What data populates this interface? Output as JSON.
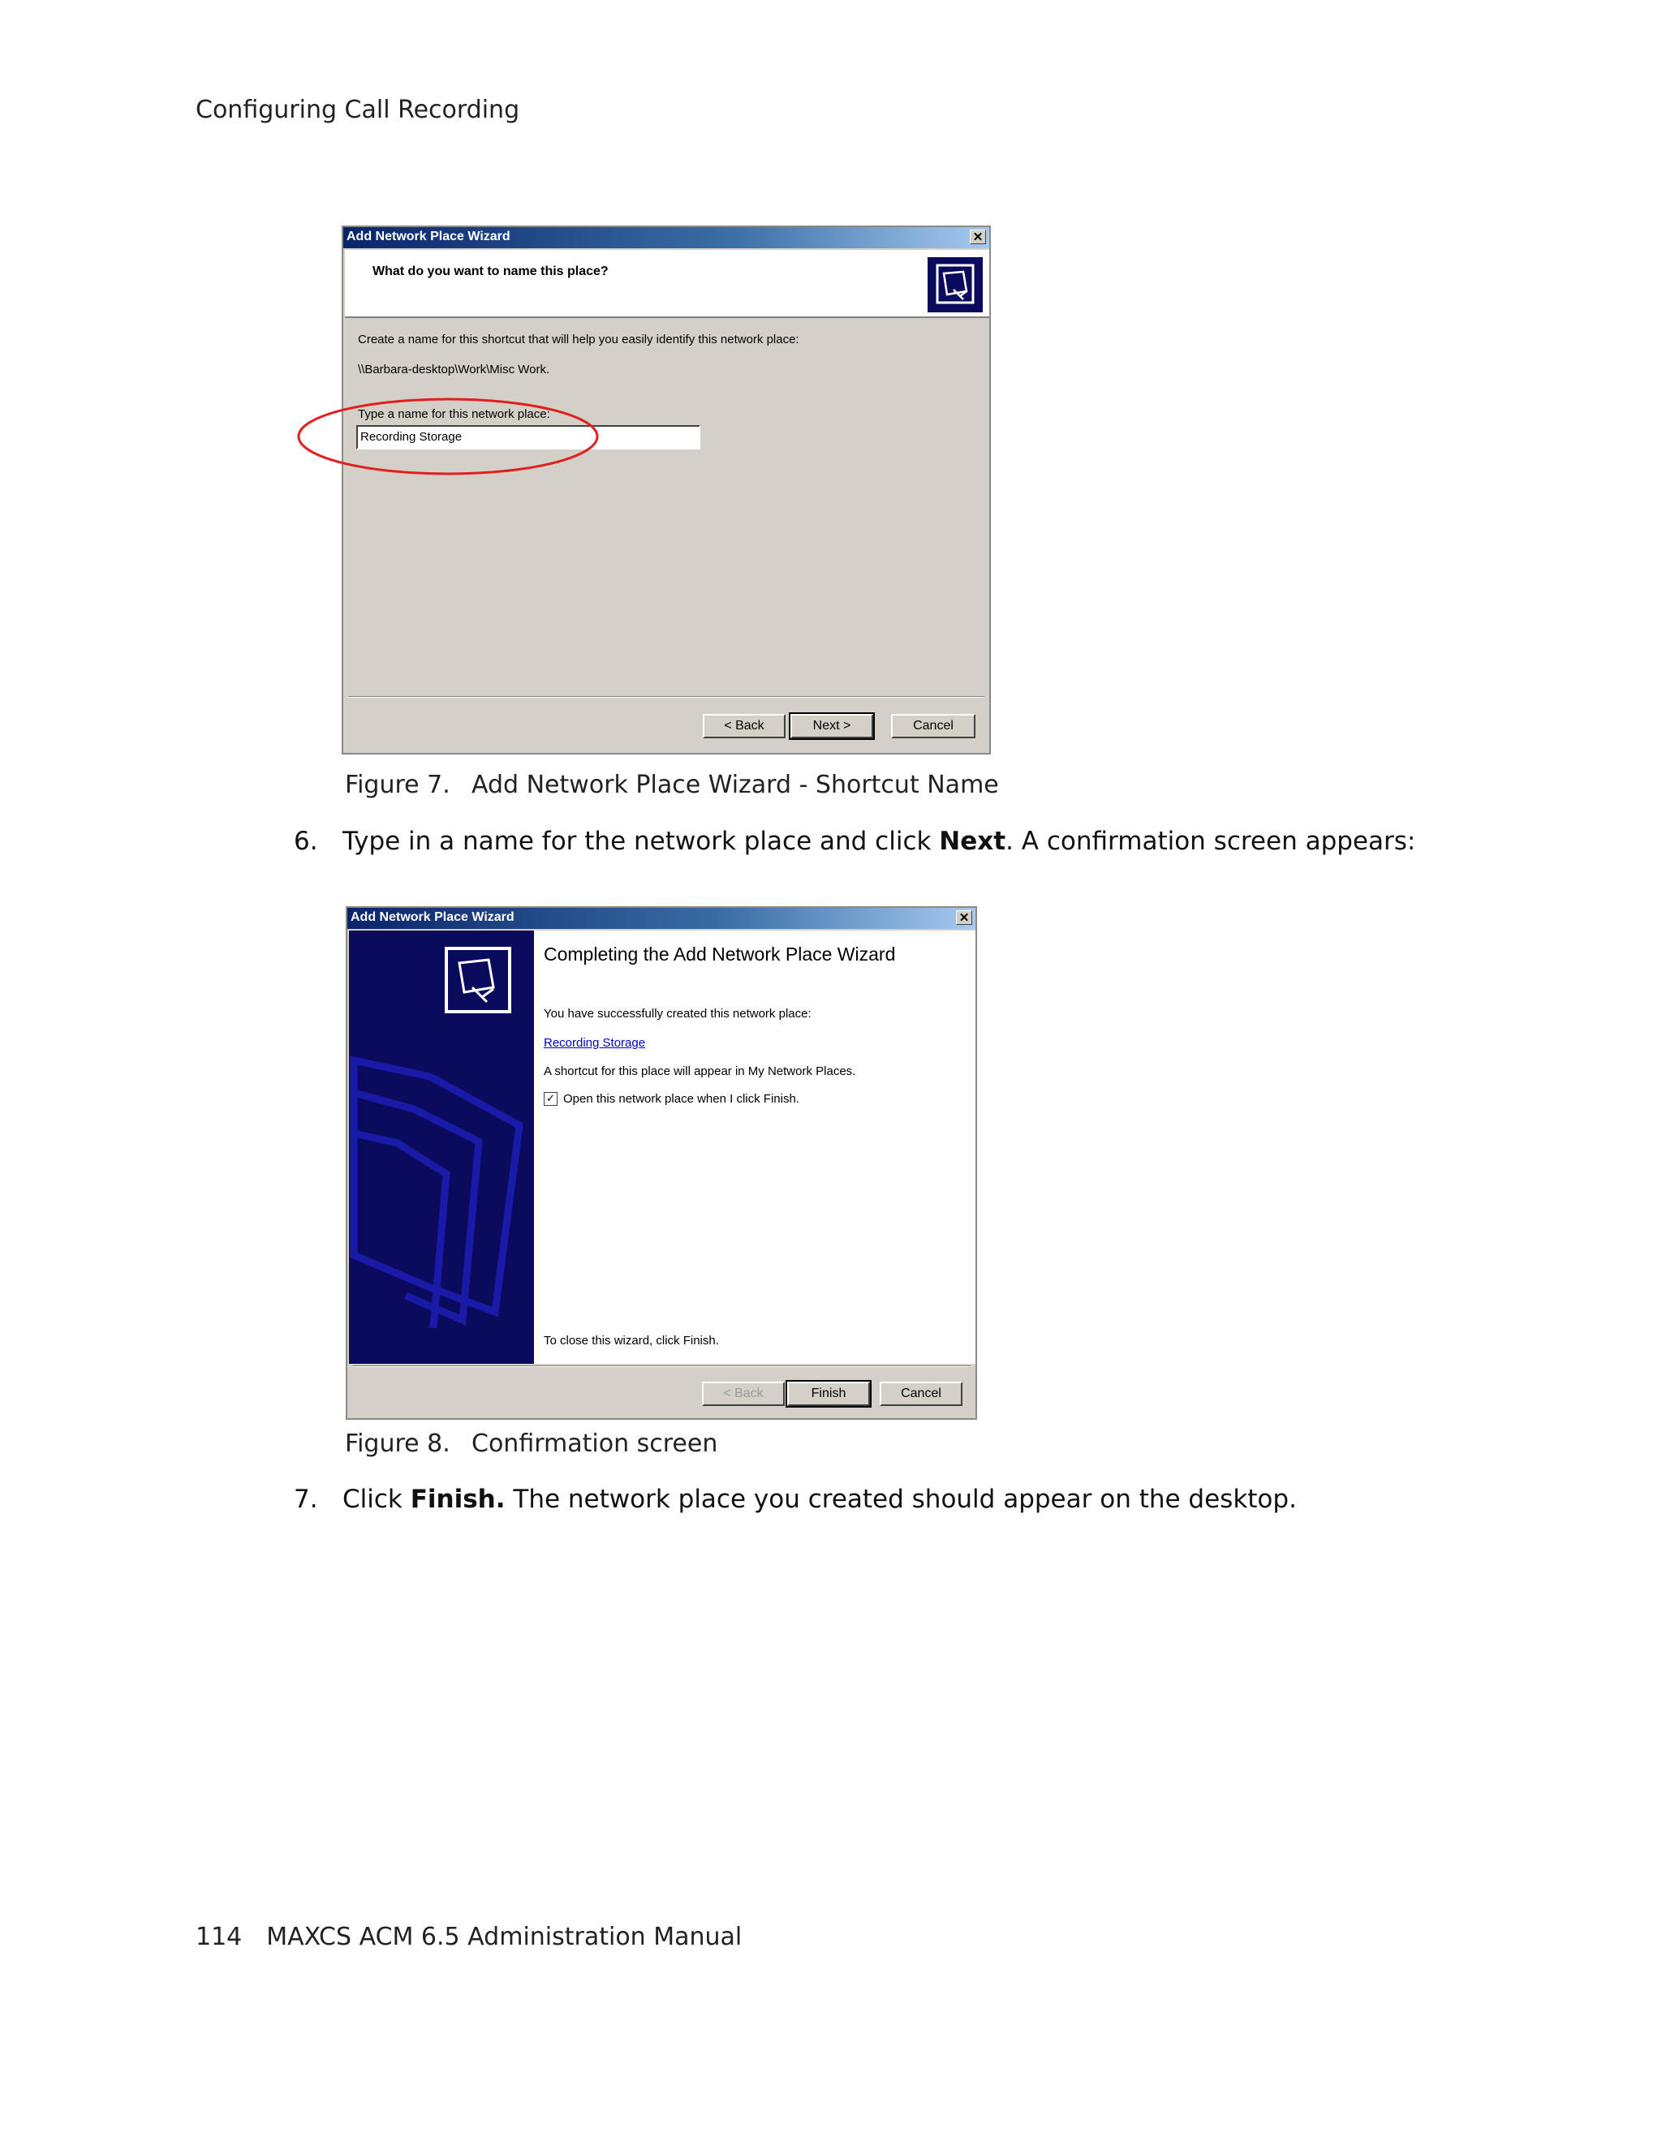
{
  "page_header": "Configuring Call Recording",
  "figure7": {
    "dialog_title": "Add Network Place Wizard",
    "close_glyph": "✕",
    "question": "What do you want to name this place?",
    "instruction": "Create a name for this shortcut that will help you easily identify this network place:",
    "path": "\\\\Barbara-desktop\\Work\\Misc Work.",
    "name_label": "Type a name for this network place:",
    "name_value": "Recording Storage",
    "back_label": "< Back",
    "next_label": "Next >",
    "cancel_label": "Cancel",
    "caption_number": "Figure 7.",
    "caption_text": "Add Network Place Wizard - Shortcut Name"
  },
  "step6": {
    "number": "6.",
    "text_before": "Type in a name for the network place and click ",
    "bold": "Next",
    "text_after": ". A confirmation screen appears:"
  },
  "figure8": {
    "dialog_title": "Add Network Place Wizard",
    "close_glyph": "✕",
    "heading": "Completing the Add Network Place Wizard",
    "success_text": "You have successfully created this network place:",
    "place_link": "Recording Storage",
    "shortcut_text": "A shortcut for this place will appear in My Network Places.",
    "checkbox_label": "Open this network place when I click Finish.",
    "checkbox_checked": true,
    "close_text": "To close this wizard, click Finish.",
    "back_label": "< Back",
    "finish_label": "Finish",
    "cancel_label": "Cancel",
    "caption_number": "Figure 8.",
    "caption_text": "Confirmation screen"
  },
  "step7": {
    "number": "7.",
    "text_before": "Click ",
    "bold": "Finish.",
    "text_after": " The network place you created should appear on the desktop."
  },
  "footer": {
    "page_number": "114",
    "title": "MAXCS ACM 6.5 Administration Manual"
  },
  "colors": {
    "title_bar_start": "#0a246a",
    "title_bar_end": "#a6caf0",
    "dialog_face": "#d4d0c8",
    "wizard_panel": "#0b0b5e",
    "highlight_ellipse": "#e02020",
    "link": "#0000cc"
  }
}
